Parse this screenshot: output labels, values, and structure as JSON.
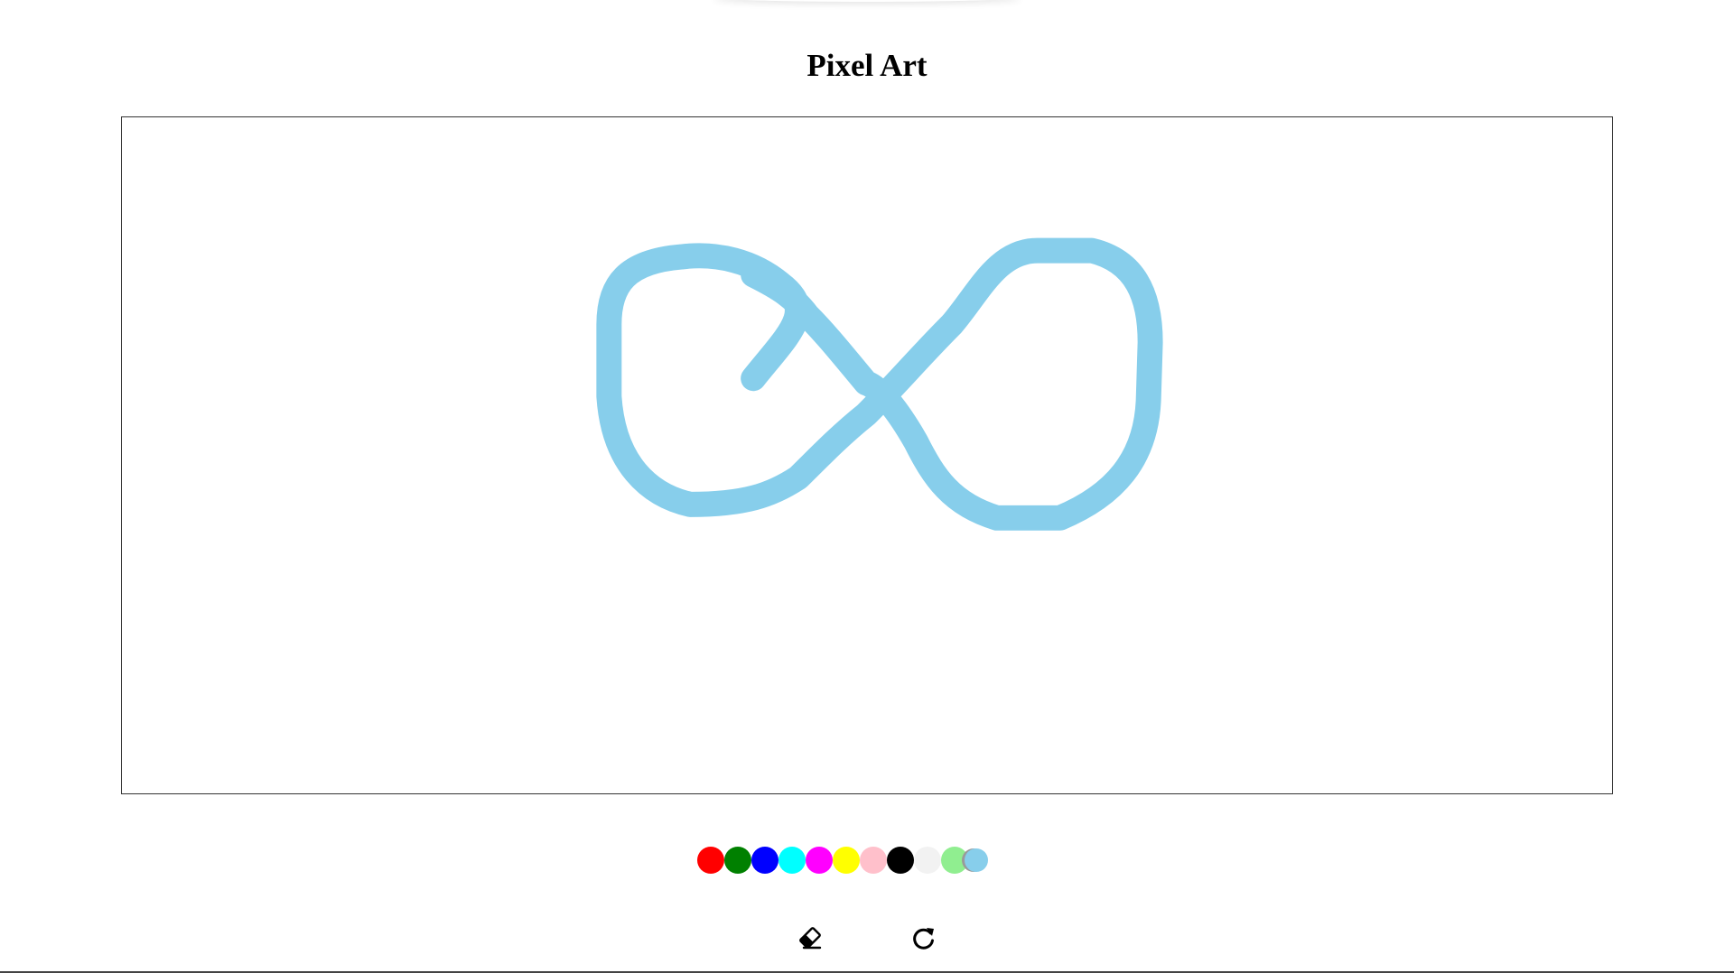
{
  "app": {
    "title": "Pixel Art"
  },
  "canvas": {
    "background": "#ffffff",
    "border_color": "#333333",
    "stroke": {
      "color": "#87ceeb"
    }
  },
  "palette": {
    "colors": [
      {
        "name": "red",
        "hex": "#ff0000"
      },
      {
        "name": "green",
        "hex": "#008000"
      },
      {
        "name": "blue",
        "hex": "#0000ff"
      },
      {
        "name": "cyan",
        "hex": "#00ffff"
      },
      {
        "name": "magenta",
        "hex": "#ff00ff"
      },
      {
        "name": "yellow",
        "hex": "#ffff00"
      },
      {
        "name": "pink",
        "hex": "#ffc0cb"
      },
      {
        "name": "black",
        "hex": "#000000"
      },
      {
        "name": "whitesmoke",
        "hex": "#f2f2f2"
      },
      {
        "name": "lightgreen",
        "hex": "#90ee90"
      },
      {
        "name": "skyblue",
        "hex": "#87ceeb"
      }
    ],
    "selected": "skyblue"
  },
  "tools": {
    "eraser_icon": "eraser-icon",
    "reset_icon": "reset-icon"
  }
}
